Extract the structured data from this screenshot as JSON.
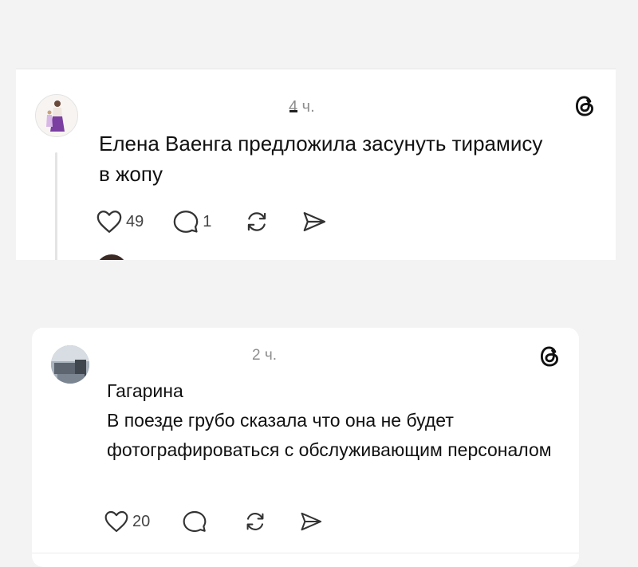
{
  "post1": {
    "time": "4 ч.",
    "text": "Елена Ваенга предложила засунуть тирамису в жопу",
    "likes": "49",
    "replies": "1",
    "icons": {
      "avatar": "avatar-image",
      "logo": "threads-logo-icon",
      "like": "heart-icon",
      "reply": "comment-bubble-icon",
      "repost": "repost-icon",
      "share": "send-icon"
    }
  },
  "post2": {
    "time": "2 ч.",
    "author": "Гагарина",
    "text": "В поезде грубо сказала что она не будет фотографироваться с обслуживающим персоналом",
    "likes": "20",
    "icons": {
      "avatar": "avatar-image",
      "logo": "threads-logo-icon",
      "like": "heart-icon",
      "reply": "comment-bubble-icon",
      "repost": "repost-icon",
      "share": "send-icon"
    }
  },
  "colors": {
    "background": "#f3f3f3",
    "card": "#ffffff",
    "text": "#111111",
    "muted": "#8e8e8e"
  }
}
